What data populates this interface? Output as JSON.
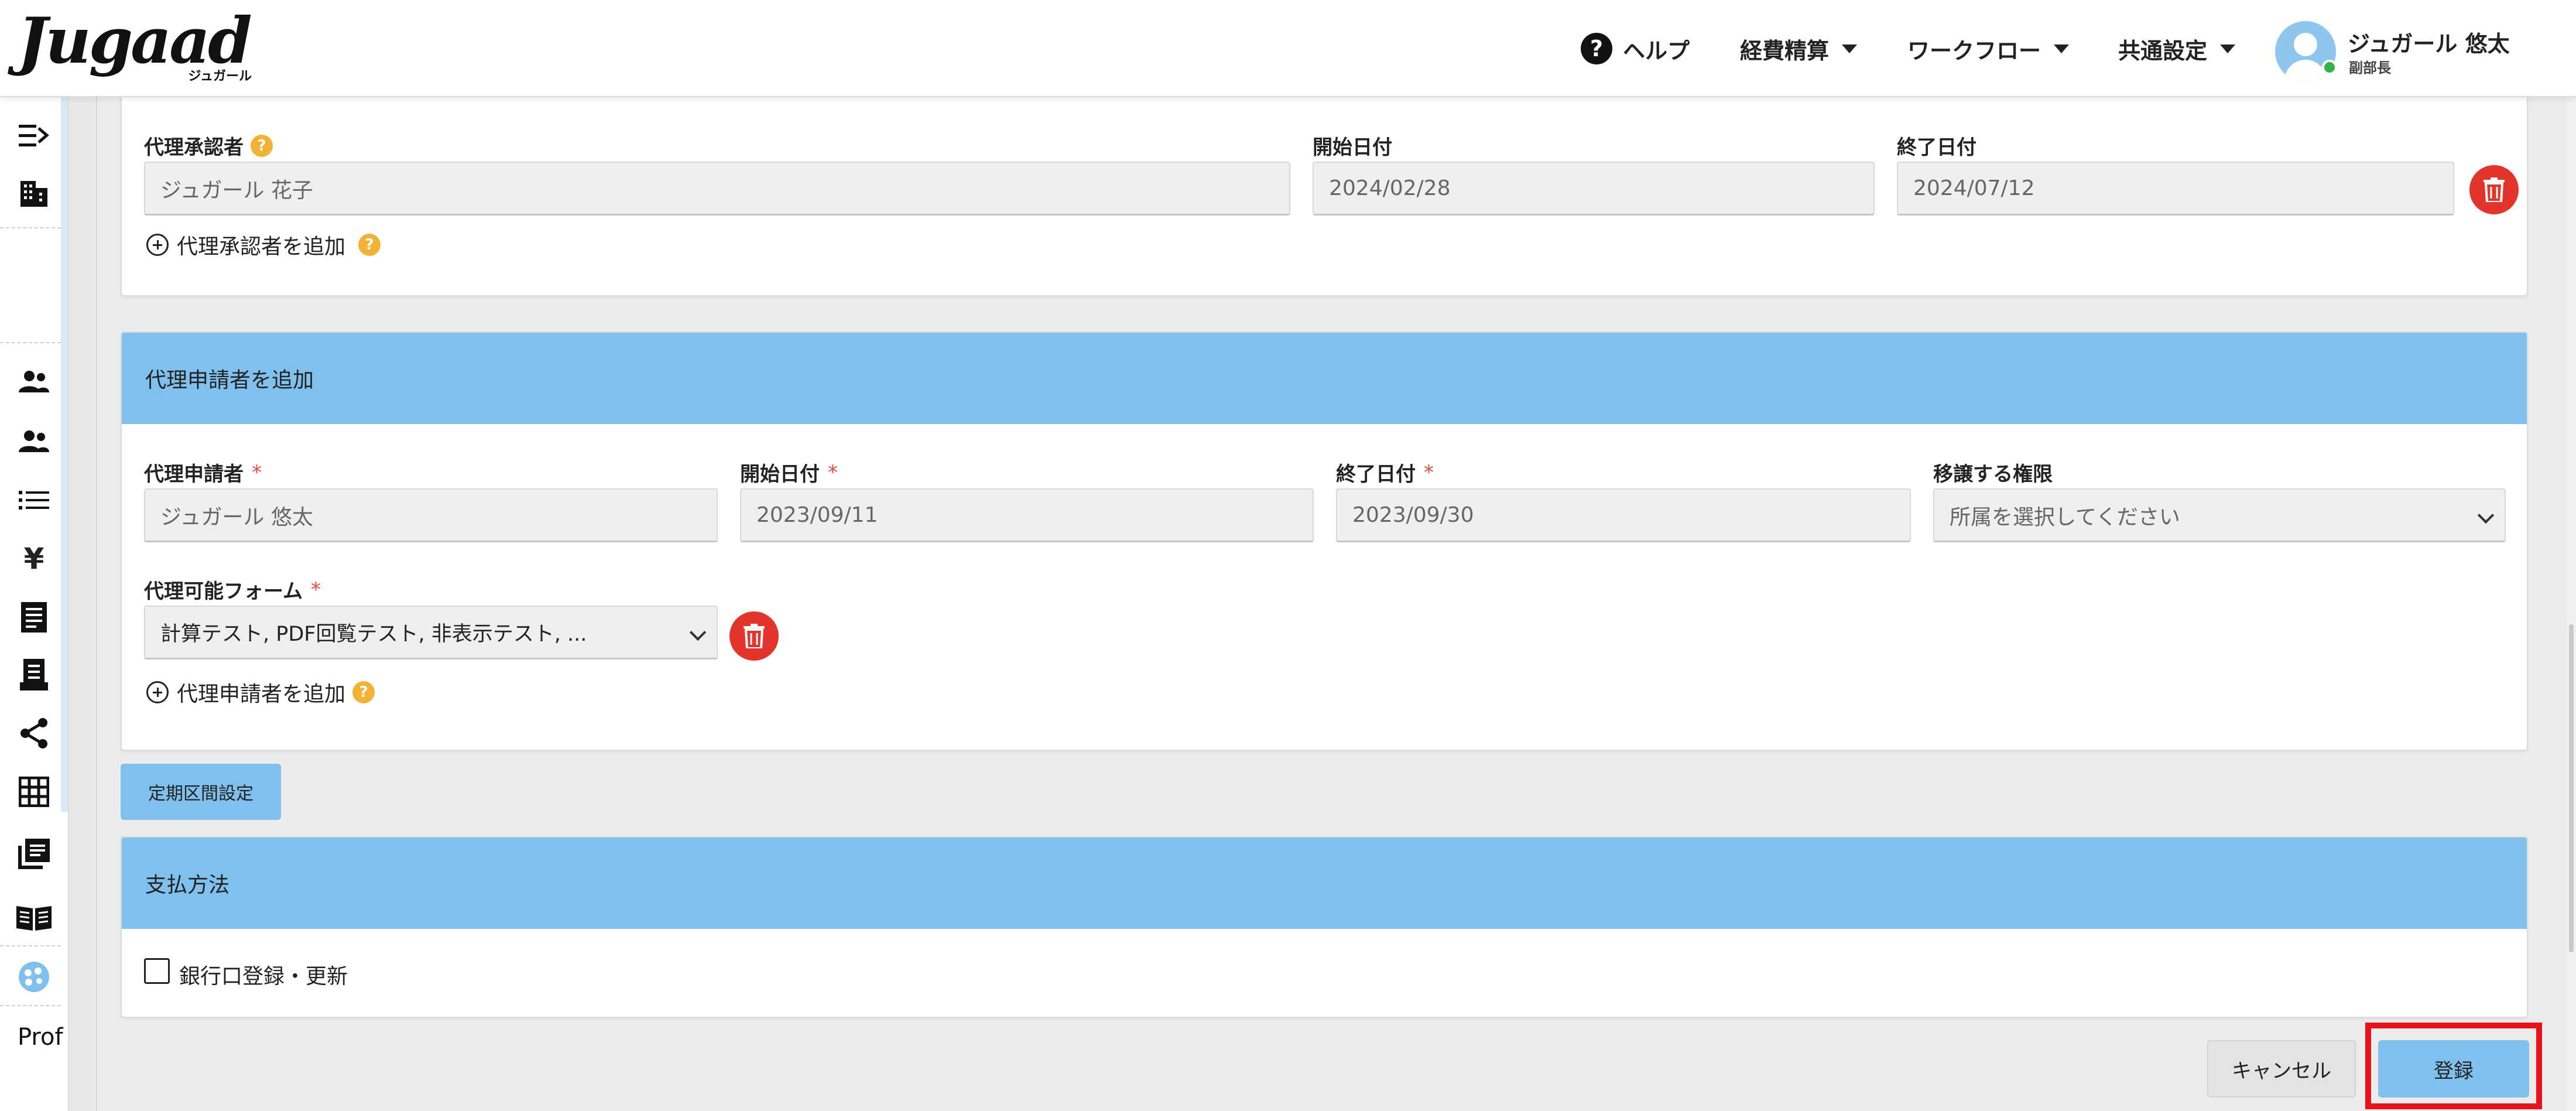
{
  "header": {
    "logo_text": "Jugaad",
    "logo_subtext": "ジュガール",
    "nav": {
      "help": "ヘルプ",
      "expense": "経費精算",
      "workflow": "ワークフロー",
      "common_settings": "共通設定"
    },
    "user": {
      "name": "ジュガール 悠太",
      "role": "副部長"
    }
  },
  "sidebar": {
    "truncated_label": "Prof"
  },
  "proxy_approver": {
    "approver_label": "代理承認者",
    "start_label": "開始日付",
    "end_label": "終了日付",
    "approver_value": "ジュガール 花子",
    "start_value": "2024/02/28",
    "end_value": "2024/07/12",
    "add_link": "代理承認者を追加"
  },
  "proxy_applicant": {
    "title": "代理申請者を追加",
    "applicant_label": "代理申請者",
    "start_label": "開始日付",
    "end_label": "終了日付",
    "authority_label": "移譲する権限",
    "applicant_value": "ジュガール 悠太",
    "start_value": "2023/09/11",
    "end_value": "2023/09/30",
    "authority_placeholder": "所属を選択してください",
    "forms_label": "代理可能フォーム",
    "forms_value": "計算テスト, PDF回覧テスト, 非表示テスト, ...",
    "add_link": "代理申請者を追加",
    "required_mark": "*"
  },
  "commute_button": "定期区間設定",
  "payment": {
    "title": "支払方法",
    "bank_checkbox_label": "銀行口登録・更新"
  },
  "footer": {
    "cancel": "キャンセル",
    "register": "登録"
  },
  "colors": {
    "accent_blue": "#7fc0ec",
    "delete_red": "#e2342b",
    "required_red": "#e34b3f",
    "help_yellow": "#f2b233",
    "highlight_red": "#e8121a",
    "online_green": "#35b34a"
  }
}
